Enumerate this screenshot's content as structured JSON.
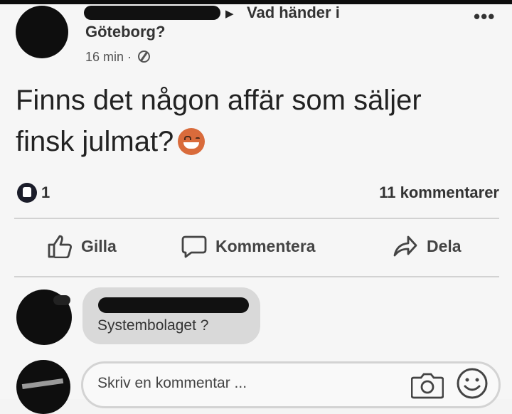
{
  "post": {
    "group_arrow": "▶",
    "group_name_line1": "Vad händer i",
    "group_name_line2": "Göteborg?",
    "timestamp": "16 min ·",
    "more_label": "•••",
    "text_line1": "Finns det någon affär som säljer",
    "text_line2": "finsk julmat?",
    "emoji": "smiling-face-emoji"
  },
  "stats": {
    "likes": "1",
    "comments": "11 kommentarer"
  },
  "actions": {
    "like": "Gilla",
    "comment": "Kommentera",
    "share": "Dela"
  },
  "comments": [
    {
      "text": "Systembolaget ?"
    }
  ],
  "composer": {
    "placeholder": "Skriv en kommentar ..."
  },
  "colors": {
    "background": "#f6f6f6",
    "comment_bubble": "#d9d9d9",
    "redaction": "#111111"
  }
}
